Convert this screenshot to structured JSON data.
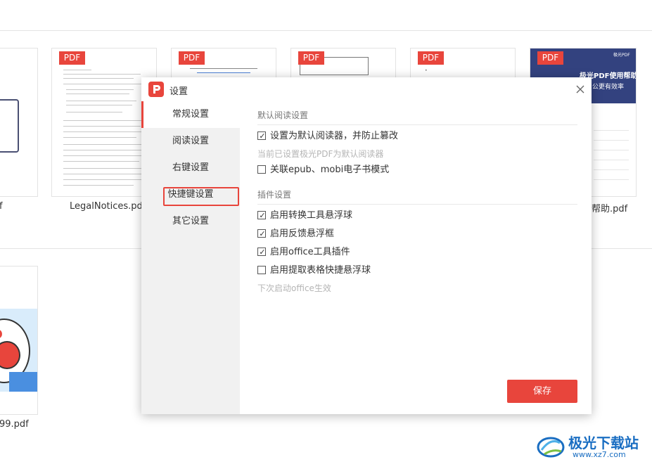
{
  "background": {
    "pdf_tag": "PDF",
    "files": [
      {
        "name": "LegalNotices.pdf"
      },
      {
        "name": "帮助.pdf"
      },
      {
        "name": "99.pdf"
      },
      {
        "name": "f"
      }
    ],
    "help_thumb": {
      "brand": "极光PDF",
      "title": "极光PDF使用帮助",
      "subtitle": "公更有效率"
    }
  },
  "dialog": {
    "title": "设置",
    "close_icon": "close-icon",
    "sidebar": {
      "items": [
        {
          "label": "常规设置"
        },
        {
          "label": "阅读设置"
        },
        {
          "label": "右键设置"
        },
        {
          "label": "快捷键设置"
        },
        {
          "label": "其它设置"
        }
      ]
    },
    "sections": {
      "default_reader": {
        "title": "默认阅读设置",
        "opt1": {
          "label": "设置为默认阅读器，并防止篡改",
          "checked": true
        },
        "hint": "当前已设置极光PDF为默认阅读器",
        "opt2": {
          "label": "关联epub、mobi电子书模式",
          "checked": false
        }
      },
      "plugins": {
        "title": "插件设置",
        "opt1": {
          "label": "启用转换工具悬浮球",
          "checked": true
        },
        "opt2": {
          "label": "启用反馈悬浮框",
          "checked": true
        },
        "opt3": {
          "label": "启用office工具插件",
          "checked": true
        },
        "opt4": {
          "label": "启用提取表格快捷悬浮球",
          "checked": false
        },
        "hint": "下次启动office生效"
      }
    },
    "save_label": "保存"
  },
  "watermark": {
    "text": "极光下载站",
    "url": "www.xz7.com"
  },
  "colors": {
    "accent": "#e8453c",
    "sidebar_bg": "#f1f1f1",
    "watermark": "#1a6ec2"
  }
}
